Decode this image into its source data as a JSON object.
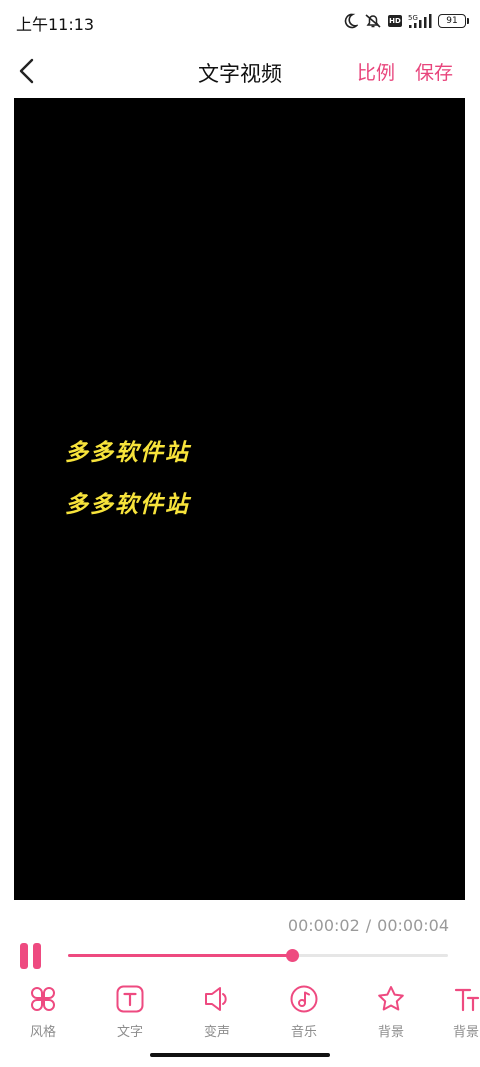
{
  "status_bar": {
    "time": "上午11:13",
    "network": "5G",
    "hd": "HD",
    "battery": "91"
  },
  "header": {
    "title": "文字视频",
    "ratio_label": "比例",
    "save_label": "保存"
  },
  "preview": {
    "lines": [
      "多多软件站",
      "多多软件站"
    ],
    "text_color": "#f7e33b",
    "background": "#000000"
  },
  "player": {
    "current_time": "00:00:02",
    "separator": "/",
    "total_time": "00:00:04",
    "progress": 0.59
  },
  "toolbar": {
    "items": [
      {
        "label": "风格",
        "icon": "style-grid-icon"
      },
      {
        "label": "文字",
        "icon": "text-icon"
      },
      {
        "label": "变声",
        "icon": "voice-change-icon"
      },
      {
        "label": "音乐",
        "icon": "music-icon"
      },
      {
        "label": "背景",
        "icon": "star-icon"
      },
      {
        "label": "背景",
        "icon": "text-style-icon"
      }
    ]
  },
  "colors": {
    "accent": "#ee4a80",
    "action_text": "#e8457c"
  }
}
